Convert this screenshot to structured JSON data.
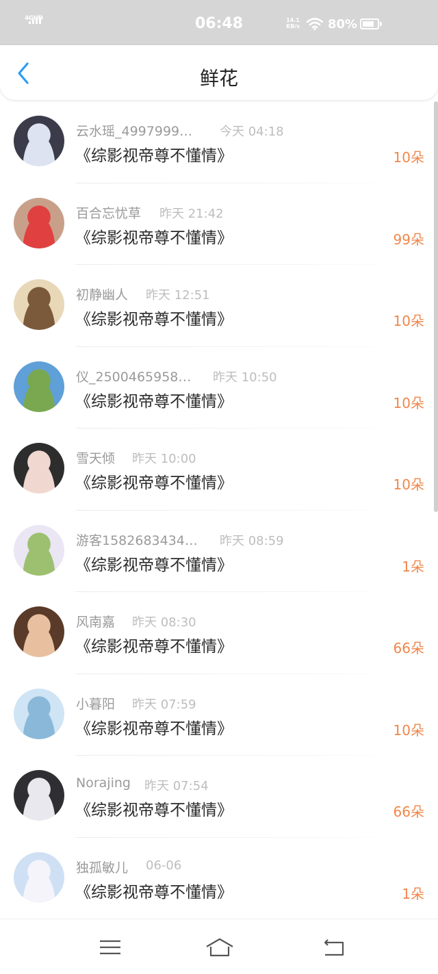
{
  "status_bar": {
    "network": "4GHD",
    "time": "06:48",
    "speed_value": "14.1",
    "speed_unit": "KB/s",
    "battery": "80%",
    "battery_level": 0.8
  },
  "header": {
    "title": "鲜花",
    "back_icon": "chevron-left-icon",
    "accent_color": "#2a9df4"
  },
  "colors": {
    "count": "#f0874a",
    "name": "#9a9a9a",
    "time": "#bdbdbd"
  },
  "items": [
    {
      "name": "云水瑶_4997999…",
      "time": "今天 04:18",
      "book": "《综影视帝尊不懂情》",
      "count": "10朵"
    },
    {
      "name": "百合忘忧草",
      "time": "昨天 21:42",
      "book": "《综影视帝尊不懂情》",
      "count": "99朵"
    },
    {
      "name": "初静幽人",
      "time": "昨天 12:51",
      "book": "《综影视帝尊不懂情》",
      "count": "10朵"
    },
    {
      "name": "仪_2500465958…",
      "time": "昨天 10:50",
      "book": "《综影视帝尊不懂情》",
      "count": "10朵"
    },
    {
      "name": "雪天倾",
      "time": "昨天 10:00",
      "book": "《综影视帝尊不懂情》",
      "count": "10朵"
    },
    {
      "name": "游客1582683434…",
      "time": "昨天 08:59",
      "book": "《综影视帝尊不懂情》",
      "count": "1朵"
    },
    {
      "name": "风南嘉",
      "time": "昨天 08:30",
      "book": "《综影视帝尊不懂情》",
      "count": "66朵"
    },
    {
      "name": "小暮阳",
      "time": "昨天 07:59",
      "book": "《综影视帝尊不懂情》",
      "count": "10朵"
    },
    {
      "name": "Norajing",
      "time": "昨天 07:54",
      "book": "《综影视帝尊不懂情》",
      "count": "66朵"
    },
    {
      "name": "独孤敏儿",
      "time": "06-06",
      "book": "《综影视帝尊不懂情》",
      "count": "1朵"
    }
  ],
  "bottom_nav": {
    "icons": [
      "menu-icon",
      "home-icon",
      "back-icon"
    ]
  }
}
